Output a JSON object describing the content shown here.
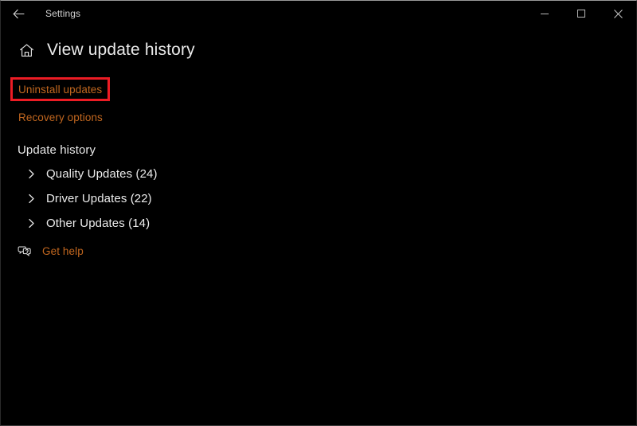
{
  "window": {
    "titlebar": {
      "app_title": "Settings",
      "back_icon": "back-arrow-icon",
      "minimize_label": "—",
      "maximize_label": "□",
      "close_label": "✕"
    }
  },
  "header": {
    "home_icon": "home-icon",
    "page_title": "View update history"
  },
  "links": [
    {
      "label": "Uninstall updates",
      "highlighted": true
    },
    {
      "label": "Recovery options",
      "highlighted": false
    }
  ],
  "section": {
    "heading": "Update history",
    "categories": [
      {
        "label": "Quality Updates (24)",
        "icon": "chevron-right-icon"
      },
      {
        "label": "Driver Updates (22)",
        "icon": "chevron-right-icon"
      },
      {
        "label": "Other Updates (14)",
        "icon": "chevron-right-icon"
      }
    ]
  },
  "help": {
    "icon": "help-chat-icon",
    "label": "Get help"
  },
  "colors": {
    "background": "#000000",
    "link": "#c2671f",
    "text": "#ececec",
    "highlight_outline": "#ec1c24"
  }
}
